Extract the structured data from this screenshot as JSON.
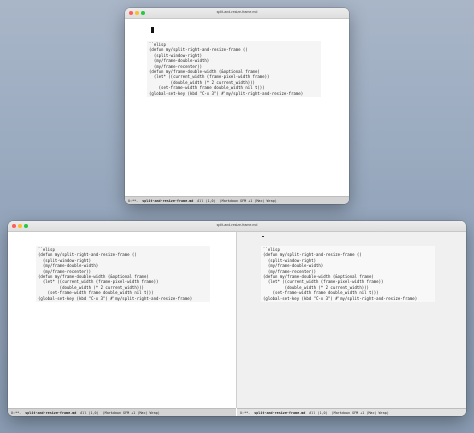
{
  "code_lines": [
    "``elisp",
    "(defun my/split-right-and-resize-frame ()",
    "  (split-window-right)",
    "  (my/frame-double-width)",
    "  (my/frame-recenter))",
    "(defun my/frame-double-width (&optional frame)",
    "  (let* ((current_width (frame-pixel-width frame))",
    "         (double_width (* 2 current_width)))",
    "    (set-frame-width frame double_width nil t)))",
    "(global-set-key (kbd \"C-x 3\") #'my/split-right-and-resize-frame)"
  ],
  "small_window": {
    "title": "split-and-resize-frame.md",
    "modeline": {
      "status": "U:**-",
      "buffer": "split-and-resize-frame.md",
      "position": "All (1,0)",
      "modes": "(Markdown GFM +1 (Mac) Wrap)"
    }
  },
  "large_window": {
    "title": "split-and-resize-frame.md",
    "left_modeline": {
      "status": "U:**-",
      "buffer": "split-and-resize-frame.md",
      "position": "All (1,0)",
      "modes": "(Markdown GFM +1 (Mac) Wrap)"
    },
    "right_modeline": {
      "status": "U:**-",
      "buffer": "split-and-resize-frame.md",
      "position": "All (1,0)",
      "modes": "(Markdown GFM +1 (Mac) Wrap)"
    }
  },
  "colors": {
    "close": "#fe5f57",
    "minimize": "#febc2e",
    "zoom": "#28c840",
    "modeline_bg": "#d4d4d4",
    "code_bg": "#f5f5f5"
  }
}
